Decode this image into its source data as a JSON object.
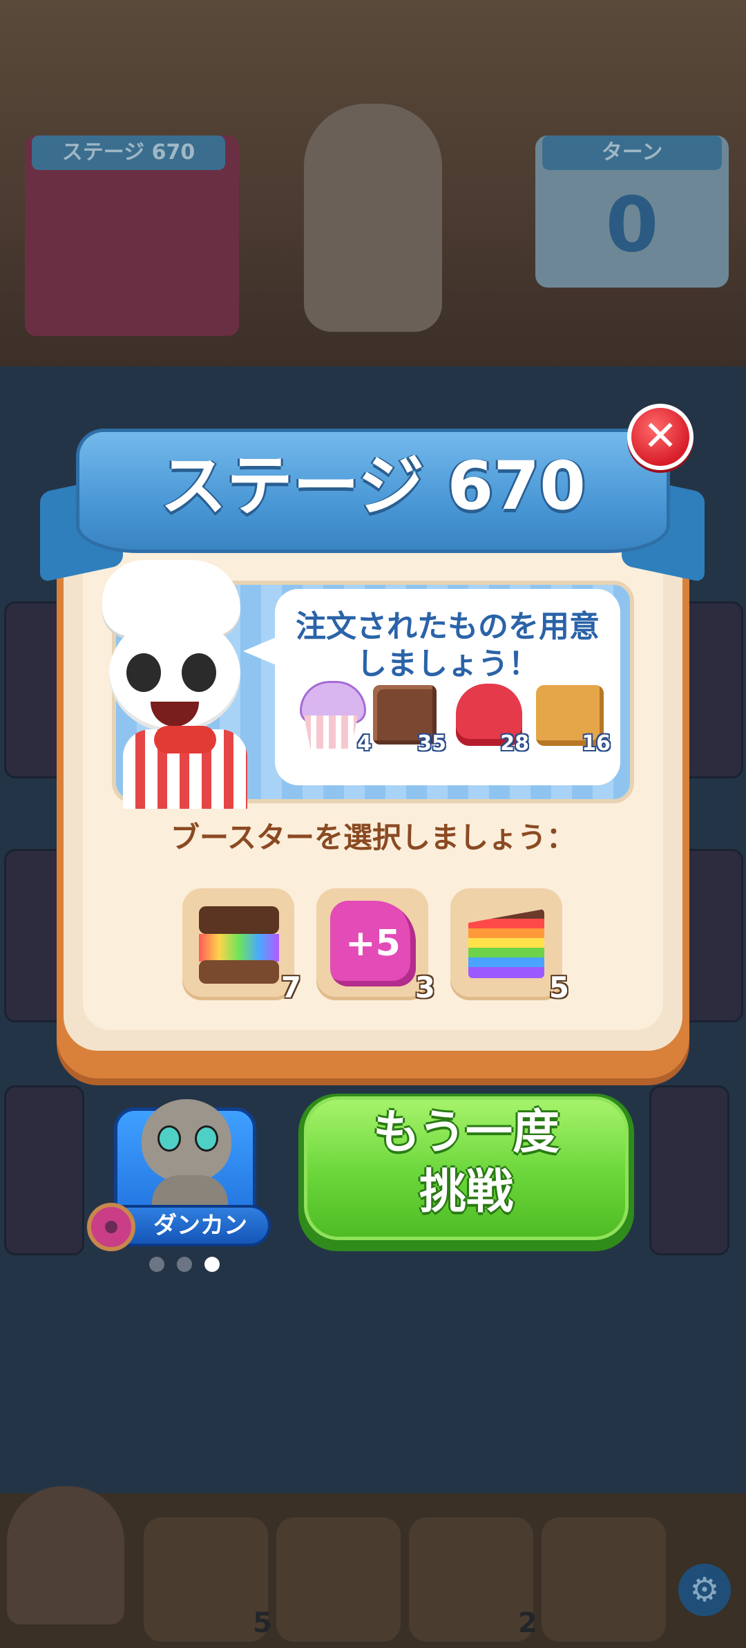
{
  "background": {
    "stage_panel_title": "ステージ 670",
    "turn_panel_title": "ターン",
    "turn_value": "0",
    "tools": [
      {
        "icon": "oven-mitt-icon",
        "count": "5"
      },
      {
        "icon": "rolling-pin-icon",
        "count": ""
      },
      {
        "icon": "piping-bag-icon",
        "count": "2"
      },
      {
        "icon": "spoon-icon",
        "count": ""
      }
    ],
    "settings_icon": "gear-icon"
  },
  "modal": {
    "title": "ステージ 670",
    "close_icon": "close-icon",
    "order_message": "注文されたものを用意しましょう！",
    "orders": [
      {
        "icon": "cupcake-icon",
        "count": "4"
      },
      {
        "icon": "chocolate-icon",
        "count": "35"
      },
      {
        "icon": "heart-macaron-icon",
        "count": "28"
      },
      {
        "icon": "cheese-cake-icon",
        "count": "16"
      }
    ],
    "booster_label": "ブースターを選択しましょう：",
    "boosters": [
      {
        "icon": "rainbow-smore-icon",
        "count": "7"
      },
      {
        "icon": "plus-five-moves-icon",
        "label": "+5",
        "count": "3"
      },
      {
        "icon": "rainbow-cake-icon",
        "count": "5"
      }
    ]
  },
  "buddy": {
    "name": "ダンカン",
    "page_dots": 3,
    "active_dot": 2
  },
  "retry_button": {
    "label": "もう一度\n挑戦"
  },
  "colors": {
    "banner_blue": "#4a98d6",
    "close_red": "#d81e2a",
    "button_green": "#6ad63a",
    "label_brown": "#8a4a22"
  }
}
